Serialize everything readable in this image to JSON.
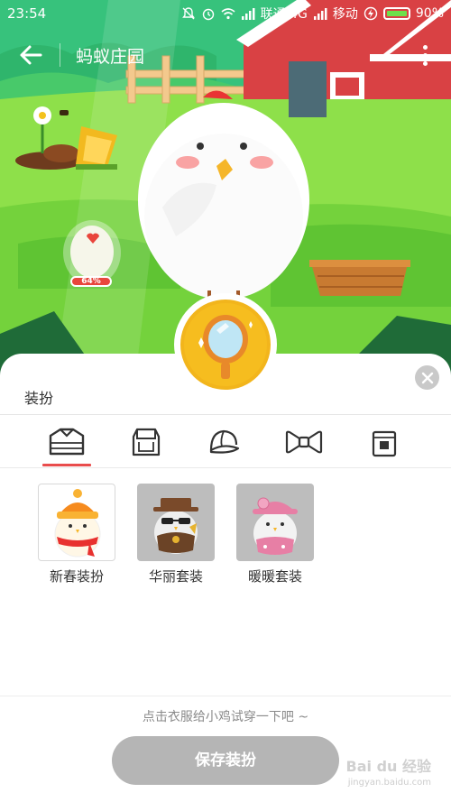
{
  "status_bar": {
    "time": "23:54",
    "carrier_1": "联通 4G",
    "carrier_2": "移动",
    "battery": "90%"
  },
  "header": {
    "title": "蚂蚁庄园"
  },
  "scene": {
    "egg_progress": "64%"
  },
  "sheet": {
    "title": "装扮",
    "tabs": [
      {
        "icon": "shirt-icon"
      },
      {
        "icon": "jacket-icon"
      },
      {
        "icon": "hat-icon"
      },
      {
        "icon": "bowtie-icon"
      },
      {
        "icon": "bag-icon"
      }
    ],
    "selected_tab": 0,
    "outfits": [
      {
        "label": "新春装扮",
        "selected": true
      },
      {
        "label": "华丽套装",
        "selected": false
      },
      {
        "label": "暖暖套装",
        "selected": false
      }
    ],
    "hint": "点击衣服给小鸡试穿一下吧 ~",
    "save_label": "保存装扮"
  },
  "watermark": {
    "text": "Bai du 经验",
    "sub": "jingyan.baidu.com"
  },
  "colors": {
    "accent_red": "#e94c4c",
    "button_gray": "#b5b5b5",
    "mirror_gold": "#f2b51c"
  }
}
